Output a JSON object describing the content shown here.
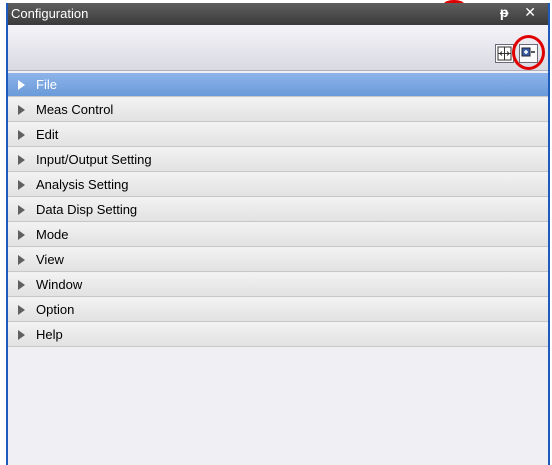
{
  "panel": {
    "title": "Configuration",
    "pin_glyph": "ᵽ",
    "close_glyph": "✕"
  },
  "toolbar": {
    "buttons": [
      {
        "icon": "expand-width-icon"
      },
      {
        "icon": "collapse-all-icon"
      }
    ]
  },
  "menu": {
    "items": [
      {
        "label": "File",
        "active": true
      },
      {
        "label": "Meas Control"
      },
      {
        "label": "Edit"
      },
      {
        "label": "Input/Output Setting"
      },
      {
        "label": "Analysis Setting"
      },
      {
        "label": "Data Disp Setting"
      },
      {
        "label": "Mode"
      },
      {
        "label": "View"
      },
      {
        "label": "Window"
      },
      {
        "label": "Option"
      },
      {
        "label": "Help"
      }
    ]
  },
  "colors": {
    "title_bar": "#4a4a4a",
    "active_item": "#7aa7e3",
    "highlight_circle": "#e00000",
    "frame_border": "#1c5bbd"
  }
}
